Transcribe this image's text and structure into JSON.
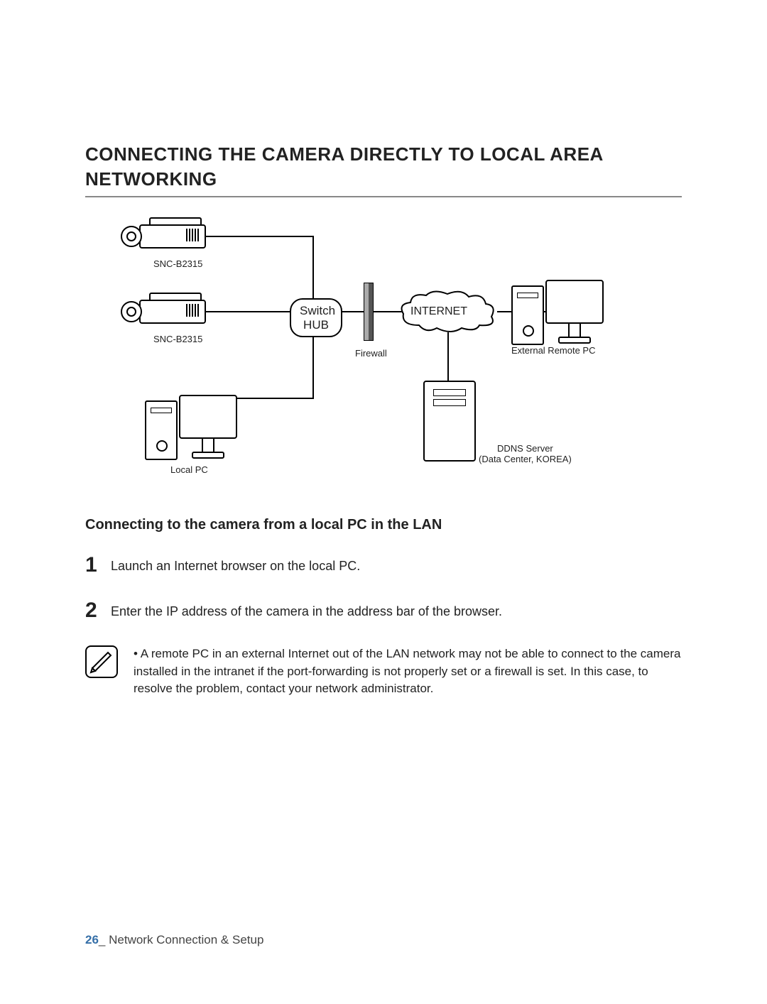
{
  "title": "CONNECTING THE CAMERA DIRECTLY TO LOCAL AREA NETWORKING",
  "diagram": {
    "camera1_label": "SNC-B2315",
    "camera2_label": "SNC-B2315",
    "switch_hub": "Switch\nHUB",
    "internet": "INTERNET",
    "firewall": "Firewall",
    "local_pc": "Local PC",
    "external_pc": "External Remote PC",
    "ddns_server": "DDNS Server\n(Data Center, KOREA)"
  },
  "sub_heading": "Connecting to the camera from a local PC in the LAN",
  "steps": [
    {
      "n": "1",
      "text": "Launch an Internet browser on the local PC."
    },
    {
      "n": "2",
      "text": "Enter the IP address of the camera in the address bar of the browser."
    }
  ],
  "note": "A remote PC in an external Internet out of the LAN network may not be able to connect to the camera installed in the intranet if the port-forwarding is not properly set or a firewall is set. In this case, to resolve the problem, contact your network administrator.",
  "footer": {
    "page": "26",
    "sep": "_",
    "section": " Network Connection & Setup"
  }
}
